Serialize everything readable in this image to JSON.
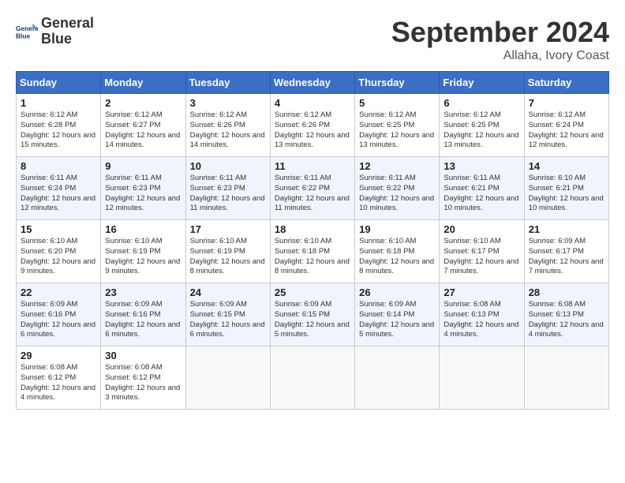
{
  "logo": {
    "line1": "General",
    "line2": "Blue"
  },
  "title": "September 2024",
  "location": "Allaha, Ivory Coast",
  "days_of_week": [
    "Sunday",
    "Monday",
    "Tuesday",
    "Wednesday",
    "Thursday",
    "Friday",
    "Saturday"
  ],
  "weeks": [
    [
      {
        "day": "1",
        "sunrise": "6:12 AM",
        "sunset": "6:28 PM",
        "daylight": "12 hours and 15 minutes."
      },
      {
        "day": "2",
        "sunrise": "6:12 AM",
        "sunset": "6:27 PM",
        "daylight": "12 hours and 14 minutes."
      },
      {
        "day": "3",
        "sunrise": "6:12 AM",
        "sunset": "6:26 PM",
        "daylight": "12 hours and 14 minutes."
      },
      {
        "day": "4",
        "sunrise": "6:12 AM",
        "sunset": "6:26 PM",
        "daylight": "12 hours and 13 minutes."
      },
      {
        "day": "5",
        "sunrise": "6:12 AM",
        "sunset": "6:25 PM",
        "daylight": "12 hours and 13 minutes."
      },
      {
        "day": "6",
        "sunrise": "6:12 AM",
        "sunset": "6:25 PM",
        "daylight": "12 hours and 13 minutes."
      },
      {
        "day": "7",
        "sunrise": "6:12 AM",
        "sunset": "6:24 PM",
        "daylight": "12 hours and 12 minutes."
      }
    ],
    [
      {
        "day": "8",
        "sunrise": "6:11 AM",
        "sunset": "6:24 PM",
        "daylight": "12 hours and 12 minutes."
      },
      {
        "day": "9",
        "sunrise": "6:11 AM",
        "sunset": "6:23 PM",
        "daylight": "12 hours and 12 minutes."
      },
      {
        "day": "10",
        "sunrise": "6:11 AM",
        "sunset": "6:23 PM",
        "daylight": "12 hours and 11 minutes."
      },
      {
        "day": "11",
        "sunrise": "6:11 AM",
        "sunset": "6:22 PM",
        "daylight": "12 hours and 11 minutes."
      },
      {
        "day": "12",
        "sunrise": "6:11 AM",
        "sunset": "6:22 PM",
        "daylight": "12 hours and 10 minutes."
      },
      {
        "day": "13",
        "sunrise": "6:11 AM",
        "sunset": "6:21 PM",
        "daylight": "12 hours and 10 minutes."
      },
      {
        "day": "14",
        "sunrise": "6:10 AM",
        "sunset": "6:21 PM",
        "daylight": "12 hours and 10 minutes."
      }
    ],
    [
      {
        "day": "15",
        "sunrise": "6:10 AM",
        "sunset": "6:20 PM",
        "daylight": "12 hours and 9 minutes."
      },
      {
        "day": "16",
        "sunrise": "6:10 AM",
        "sunset": "6:19 PM",
        "daylight": "12 hours and 9 minutes."
      },
      {
        "day": "17",
        "sunrise": "6:10 AM",
        "sunset": "6:19 PM",
        "daylight": "12 hours and 8 minutes."
      },
      {
        "day": "18",
        "sunrise": "6:10 AM",
        "sunset": "6:18 PM",
        "daylight": "12 hours and 8 minutes."
      },
      {
        "day": "19",
        "sunrise": "6:10 AM",
        "sunset": "6:18 PM",
        "daylight": "12 hours and 8 minutes."
      },
      {
        "day": "20",
        "sunrise": "6:10 AM",
        "sunset": "6:17 PM",
        "daylight": "12 hours and 7 minutes."
      },
      {
        "day": "21",
        "sunrise": "6:09 AM",
        "sunset": "6:17 PM",
        "daylight": "12 hours and 7 minutes."
      }
    ],
    [
      {
        "day": "22",
        "sunrise": "6:09 AM",
        "sunset": "6:16 PM",
        "daylight": "12 hours and 6 minutes."
      },
      {
        "day": "23",
        "sunrise": "6:09 AM",
        "sunset": "6:16 PM",
        "daylight": "12 hours and 6 minutes."
      },
      {
        "day": "24",
        "sunrise": "6:09 AM",
        "sunset": "6:15 PM",
        "daylight": "12 hours and 6 minutes."
      },
      {
        "day": "25",
        "sunrise": "6:09 AM",
        "sunset": "6:15 PM",
        "daylight": "12 hours and 5 minutes."
      },
      {
        "day": "26",
        "sunrise": "6:09 AM",
        "sunset": "6:14 PM",
        "daylight": "12 hours and 5 minutes."
      },
      {
        "day": "27",
        "sunrise": "6:08 AM",
        "sunset": "6:13 PM",
        "daylight": "12 hours and 4 minutes."
      },
      {
        "day": "28",
        "sunrise": "6:08 AM",
        "sunset": "6:13 PM",
        "daylight": "12 hours and 4 minutes."
      }
    ],
    [
      {
        "day": "29",
        "sunrise": "6:08 AM",
        "sunset": "6:12 PM",
        "daylight": "12 hours and 4 minutes."
      },
      {
        "day": "30",
        "sunrise": "6:08 AM",
        "sunset": "6:12 PM",
        "daylight": "12 hours and 3 minutes."
      },
      null,
      null,
      null,
      null,
      null
    ]
  ]
}
